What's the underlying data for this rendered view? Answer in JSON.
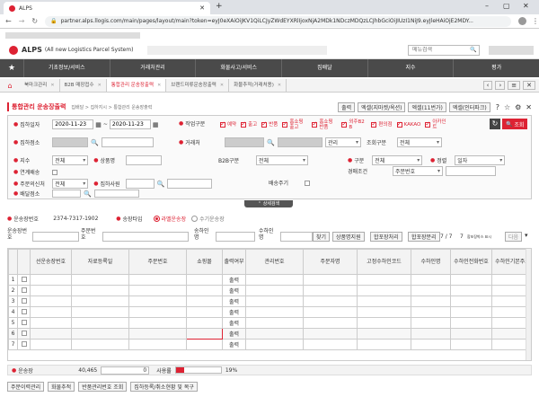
{
  "browser": {
    "tab_title": "ALPS",
    "url": "partner.alps.llogis.com/main/pages/layout/main?token=eyJ0eXAiOiJKV1QiLCJyZWdEYXRlIjoxNjA2MDk1NDczMDQzLCJhbGciOiJIUzI1NiJ9.eyJleHAiOjE2MDY..."
  },
  "app": {
    "logo": "ALPS",
    "logo_sub": "(All new Logistics Parcel System)",
    "search_placeholder": "메뉴검색"
  },
  "nav": [
    "기초정보/서비스",
    "거래처관리",
    "화물사고/서비스",
    "집배달",
    "지수",
    "평가"
  ],
  "tabs": [
    "북마크관리",
    "B2B 매장접수",
    "통합관리 운송장출력",
    "브랜드미류운송장출력",
    "화물추적(거래처용)"
  ],
  "page": {
    "title": "통합관리 운송장출력",
    "breadcrumb": "집배달 > 집하지시 > 통합관리 운송장출력"
  },
  "toolbar": {
    "print": "출력",
    "excel_upload": "엑셀(지마켓/옥션)",
    "excel_1": "엑셀(11번가)",
    "excel_interpark": "엑셀(인터파크)",
    "search": "조회"
  },
  "filters": {
    "pickup_date_label": "집하일자",
    "date_from": "2020-11-23",
    "date_to": "2020-11-23",
    "work_type_label": "작업구분",
    "checks": [
      "예약",
      "출고",
      "반품",
      "홈쇼핑출고",
      "홈쇼핑반품",
      "외주B2B",
      "편의점",
      "KAKAO",
      "아카인트"
    ],
    "pickup_place_label": "집하점소",
    "account_label": "거래처",
    "manage_value": "관리",
    "query_type_label": "조회구분",
    "query_type_value": "전체",
    "courier_label": "지수",
    "courier_value": "전체",
    "product_label": "상품명",
    "b2b_label": "B2B구분",
    "b2b_value": "전체",
    "div_label": "구분",
    "div_value": "전체",
    "sort_label": "정렬",
    "sort_value": "일자",
    "multi_label": "연계배송",
    "mapping_label": "경매조건",
    "mapping_value": "주문번호",
    "order_name_label": "주문의신처",
    "order_name_value": "전체",
    "pickup_emp_label": "집하사원",
    "ship_label": "배송주기",
    "deliv_place_label": "배달점소",
    "detail_toggle": "상세검색"
  },
  "waybill": {
    "label": "운송장번호",
    "value": "2374-7317-1902",
    "type_label": "송장타입",
    "radio1": "라벨운송장",
    "radio2": "수기운송장"
  },
  "search2": {
    "waybill_label": "운송장번호",
    "order_label": "주문번호",
    "sender_label": "송하인명",
    "receiver_label": "수하인명",
    "find_btn": "찾기",
    "product_btn": "상품명지원",
    "merge_btn": "합포장처리",
    "merge_cancel_btn": "합포장분리",
    "page_info": "7 / 7",
    "page_info2": "7",
    "page_note": "합포장박스 표시",
    "next_btn": "다음"
  },
  "grid": {
    "headers": [
      "",
      "",
      "선운송장번호",
      "자료등록일",
      "주문번호",
      "쇼핑몰",
      "출력여부",
      "관리번호",
      "주문자명",
      "고정수하인코드",
      "수하인명",
      "수하인전화번호",
      "수하인기본주소"
    ],
    "rows": [
      {
        "num": "1",
        "status": "출력"
      },
      {
        "num": "2",
        "status": "출력"
      },
      {
        "num": "3",
        "status": "출력"
      },
      {
        "num": "4",
        "status": "출력"
      },
      {
        "num": "5",
        "status": "출력"
      },
      {
        "num": "6",
        "status": "출력"
      },
      {
        "num": "7",
        "status": "출력"
      }
    ]
  },
  "footer": {
    "waybill_label": "운송장",
    "waybill_value": "40,465",
    "zero": "0",
    "usage_label": "사용률",
    "usage_percent": "19%",
    "usage_fraction": 0.19,
    "buttons": [
      "주문이력관리",
      "화물추적",
      "반품관리번호 조회",
      "집하등록/취소현황 및 복구"
    ]
  }
}
